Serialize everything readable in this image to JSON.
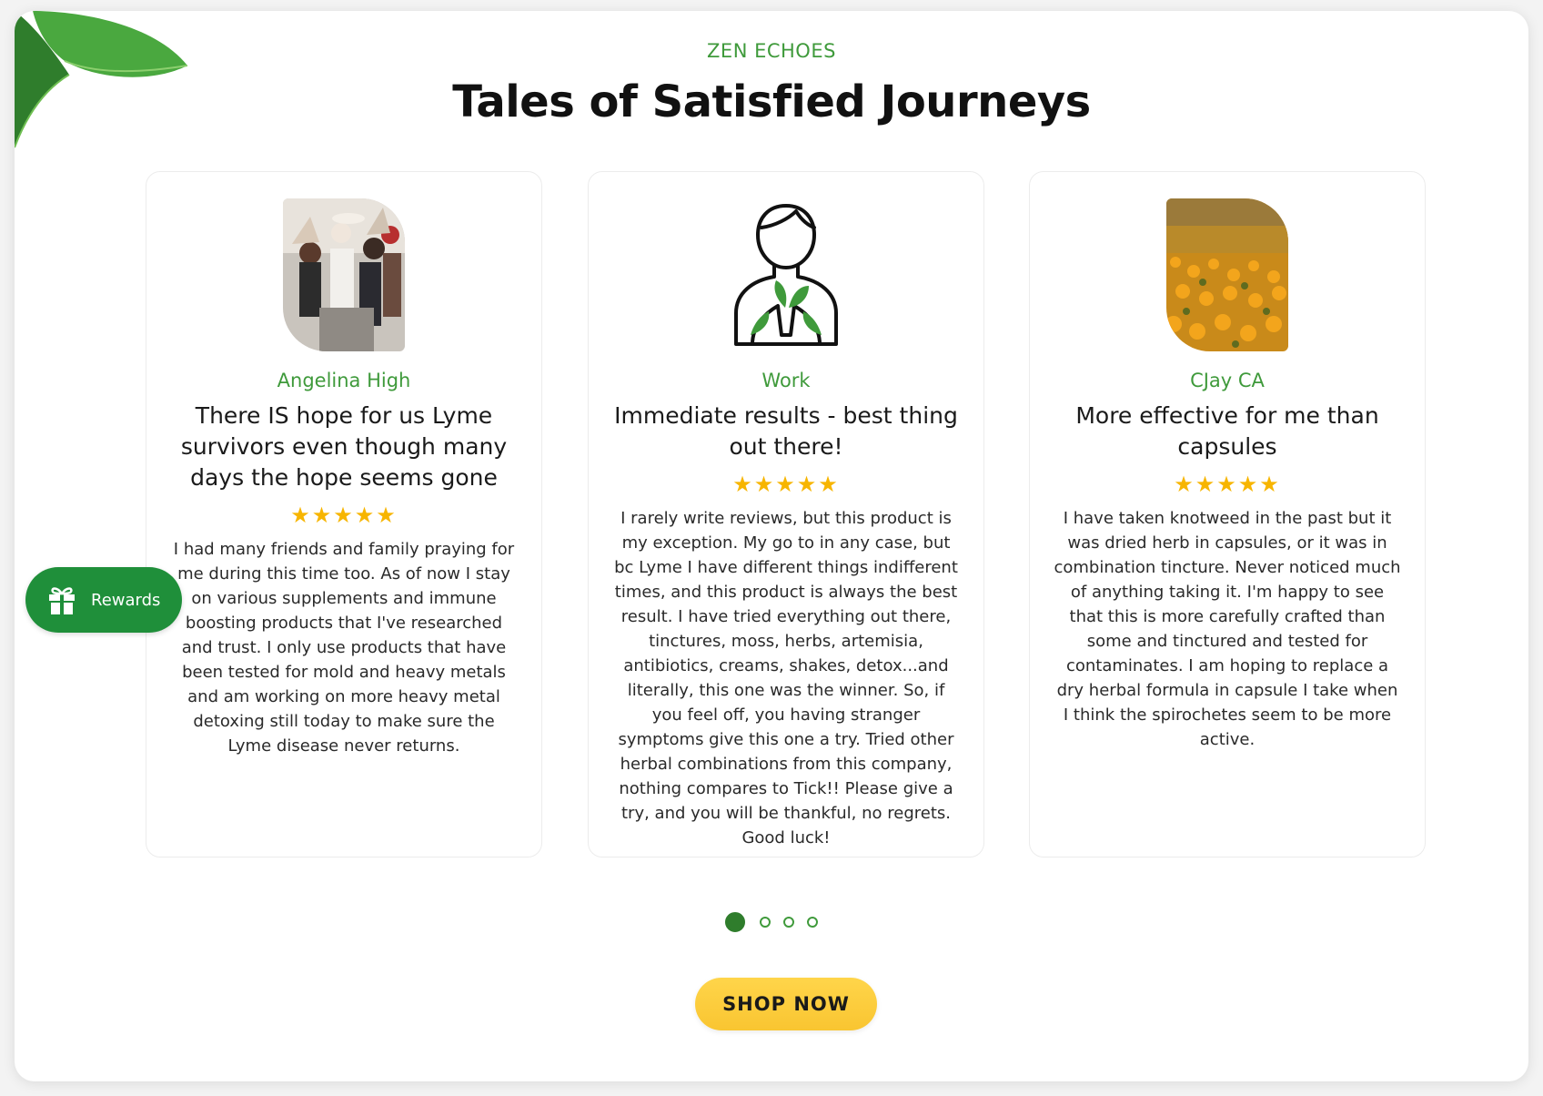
{
  "section": {
    "eyebrow": "ZEN ECHOES",
    "title": "Tales of Satisfied Journeys"
  },
  "reviews": [
    {
      "author": "Angelina High",
      "title": "There IS hope for us Lyme survivors even though many days the hope seems gone",
      "stars": "★★★★★",
      "rating": 5,
      "body": "I had many friends and family praying for me during this time too. As of now I stay on various supplements and immune boosting products that I've researched and trust. I only use products that have been tested for mold and heavy metals and am working on more heavy metal detoxing still today to make sure the Lyme disease never returns.",
      "image": "wedding-celebration-photo"
    },
    {
      "author": "Work",
      "title": "Immediate results - best thing out there!",
      "stars": "★★★★★",
      "rating": 5,
      "body": "I rarely write reviews, but this product is my exception. My go to in any case, but bc Lyme I have different things indifferent times, and this product is always the best result. I have tried everything out there, tinctures, moss, herbs, artemisia, antibiotics, creams, shakes, detox...and literally, this one was the winner. So, if you feel off, you having stranger symptoms give this one a try. Tried other herbal combinations from this company, nothing compares to Tick!! Please give a try, and you will be thankful, no regrets. Good luck!",
      "image": "person-with-leaf-icon"
    },
    {
      "author": "CJay CA",
      "title": "More effective for me than capsules",
      "stars": "★★★★★",
      "rating": 5,
      "body": "I have taken knotweed in the past but it was dried herb in capsules, or it was in combination tincture. Never noticed much of anything taking it. I'm happy to see that this is more carefully crafted than some and tinctured and tested for contaminates. I am hoping to replace a dry herbal formula in capsule I take when I think the spirochetes seem to be more active.",
      "image": "poppy-field-photo"
    }
  ],
  "rewards": {
    "label": "Rewards",
    "icon": "gift-icon"
  },
  "pagination": {
    "pages": 4,
    "active": 1
  },
  "cta": {
    "label": "SHOP NOW"
  },
  "colors": {
    "accent_green": "#3f9a3b",
    "rewards_green": "#1f8f3a",
    "star": "#f7b500",
    "button_yellow": "#f9c531"
  }
}
